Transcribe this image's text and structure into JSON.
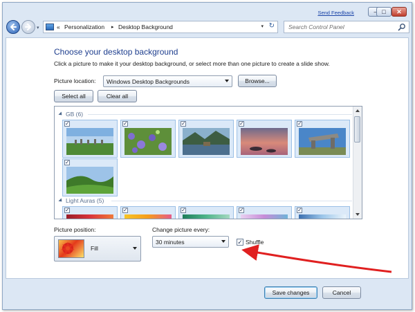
{
  "window": {
    "feedback_link": "Send Feedback",
    "minimize_glyph": "–",
    "maximize_glyph": "□",
    "close_glyph": "✕"
  },
  "nav": {
    "recent_glyph": "▾",
    "breadcrumb_prefix": "«",
    "crumbs": [
      "Personalization",
      "Desktop Background"
    ],
    "crumb_separator": "▸",
    "dropdown_glyph": "▾",
    "refresh_glyph": "↻",
    "search_placeholder": "Search Control Panel",
    "icons": [
      "back-arrow-icon",
      "forward-arrow-icon",
      "control-panel-icon",
      "refresh-icon",
      "search-icon"
    ]
  },
  "main": {
    "heading": "Choose your desktop background",
    "instructions": "Click a picture to make it your desktop background, or select more than one picture to create a slide show.",
    "location_label": "Picture location:",
    "location_value": "Windows Desktop Backgrounds",
    "browse_label": "Browse...",
    "select_all_label": "Select all",
    "clear_all_label": "Clear all"
  },
  "gallery": {
    "groups": [
      {
        "title": "GB (6)",
        "checked": [
          true,
          true,
          true,
          true,
          true,
          true
        ]
      },
      {
        "title": "Light Auras (5)",
        "checked": [
          true,
          true,
          true,
          true,
          true
        ]
      }
    ],
    "check_glyph": "✓"
  },
  "options": {
    "position_label": "Picture position:",
    "position_value": "Fill",
    "interval_label": "Change picture every:",
    "interval_value": "30 minutes",
    "shuffle_label": "Shuffle",
    "shuffle_checked": true
  },
  "footer": {
    "save_label": "Save changes",
    "cancel_label": "Cancel"
  },
  "annotation": {
    "arrow_color": "#e02020"
  }
}
